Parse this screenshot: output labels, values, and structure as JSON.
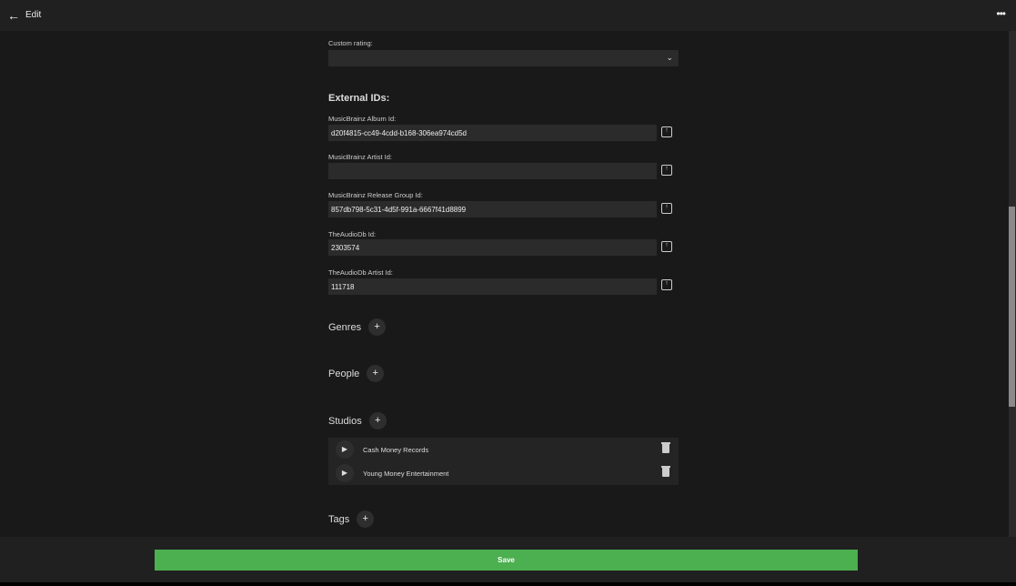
{
  "header": {
    "title": "Edit",
    "back_icon": "arrow-left",
    "more_icon": "ellipsis"
  },
  "custom_rating": {
    "label": "Custom rating:",
    "value": ""
  },
  "external_ids": {
    "heading": "External IDs:",
    "fields": [
      {
        "label": "MusicBrainz Album Id:",
        "value": "d20f4815-cc49-4cdd-b168-306ea974cd5d"
      },
      {
        "label": "MusicBrainz Artist Id:",
        "value": ""
      },
      {
        "label": "MusicBrainz Release Group Id:",
        "value": "857db798-5c31-4d5f-991a-6667f41d8899"
      },
      {
        "label": "TheAudioDb Id:",
        "value": "2303574"
      },
      {
        "label": "TheAudioDb Artist Id:",
        "value": "111718"
      }
    ]
  },
  "sections": {
    "genres": "Genres",
    "people": "People",
    "studios": "Studios",
    "tags": "Tags",
    "plus": "+"
  },
  "studios": [
    "Cash Money Records",
    "Young Money Entertainment"
  ],
  "footer": {
    "save": "Save"
  },
  "colors": {
    "accent": "#4caf50"
  }
}
